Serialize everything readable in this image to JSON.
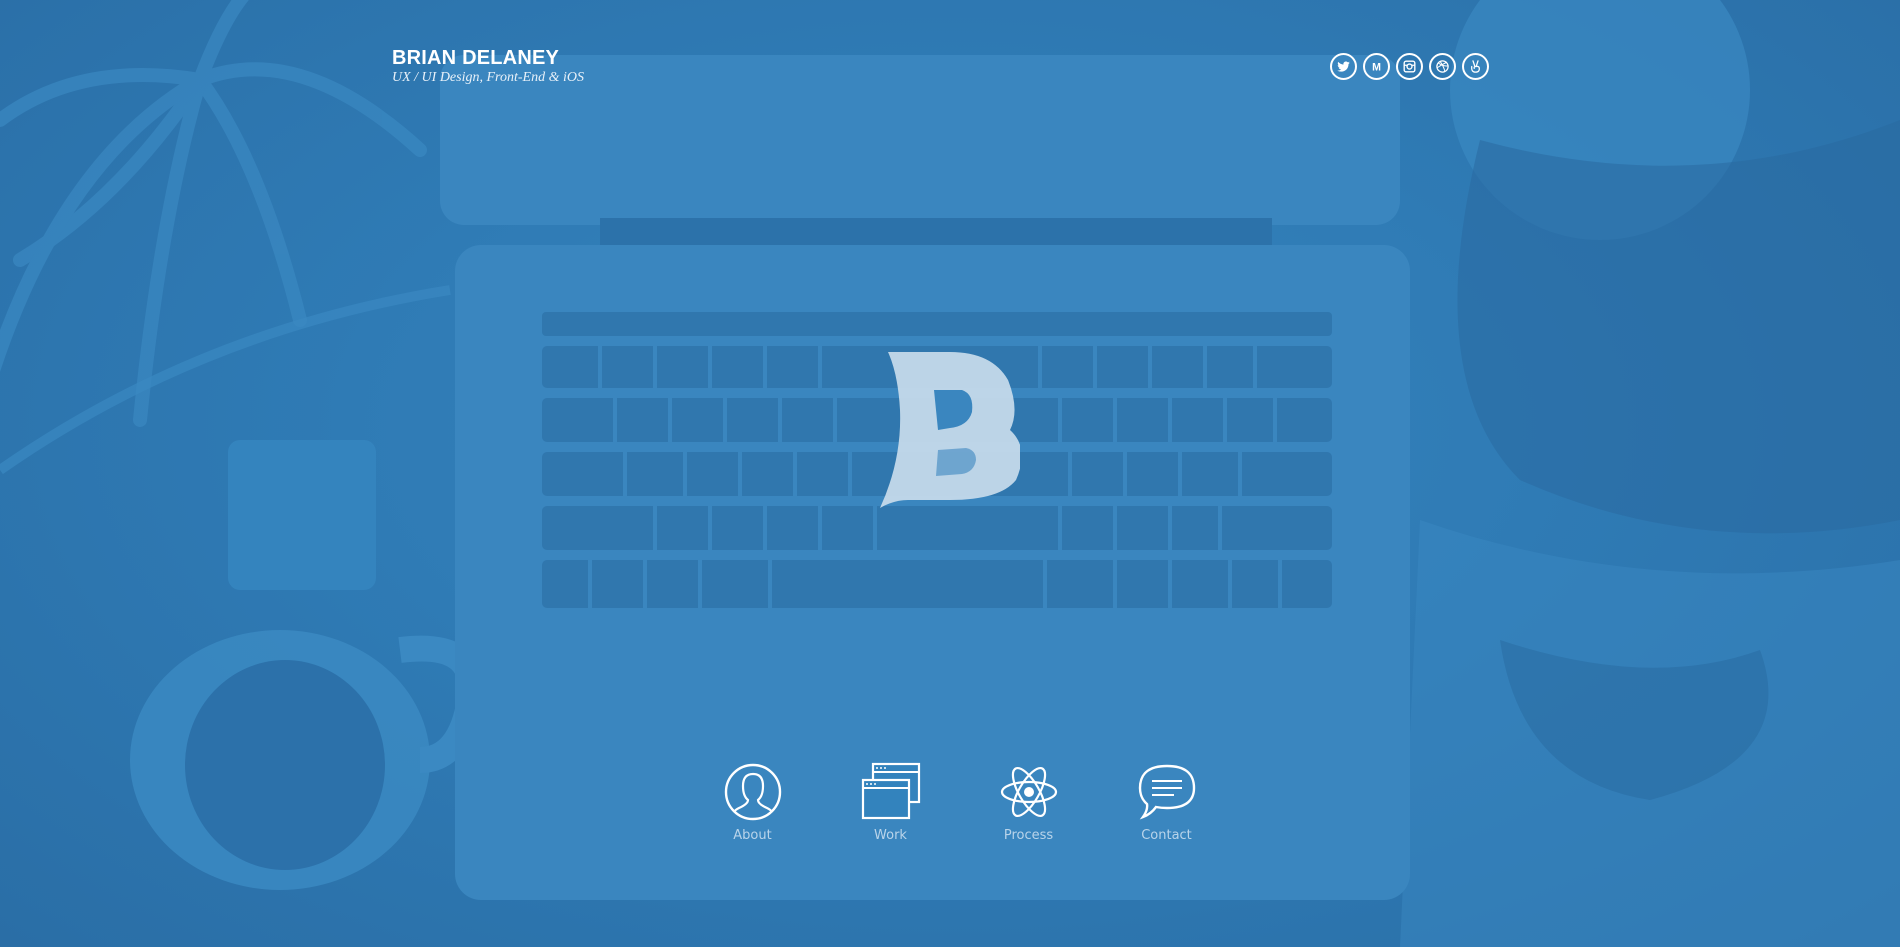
{
  "header": {
    "name": "BRIAN DELANEY",
    "tagline": "UX / UI Design, Front-End & iOS"
  },
  "social": [
    {
      "icon": "twitter-icon"
    },
    {
      "icon": "medium-icon",
      "glyph": "M"
    },
    {
      "icon": "instagram-icon"
    },
    {
      "icon": "dribbble-icon"
    },
    {
      "icon": "angellist-icon"
    }
  ],
  "nav": [
    {
      "label": "About",
      "icon": "person-icon"
    },
    {
      "label": "Work",
      "icon": "windows-icon"
    },
    {
      "label": "Process",
      "icon": "atom-icon"
    },
    {
      "label": "Contact",
      "icon": "speech-bubble-icon"
    }
  ],
  "colors": {
    "background": "#2f7bb5",
    "laptop": "#3a86bf",
    "keys": "#2f76ad",
    "logo": "#c9dcec",
    "text": "#ffffff",
    "nav_label": "#b9d4ea"
  }
}
